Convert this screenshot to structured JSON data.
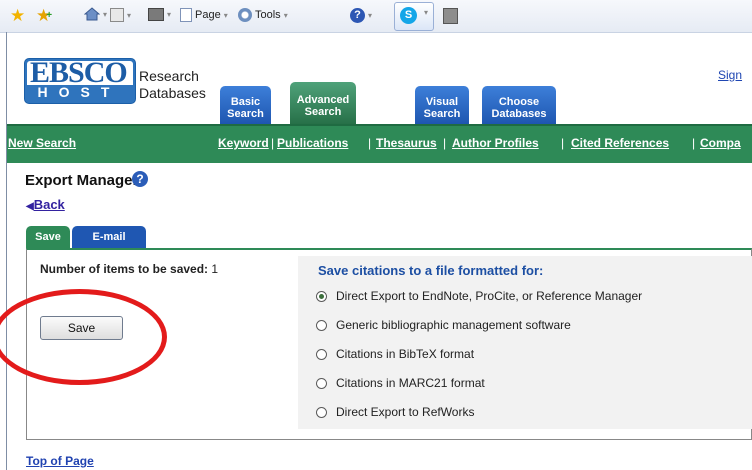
{
  "browser": {
    "page_menu": "Page",
    "tools_menu": "Tools"
  },
  "header": {
    "brand_line1": "Research",
    "brand_line2": "Databases",
    "signin": "Sign"
  },
  "main_tabs": [
    {
      "line1": "Basic",
      "line2": "Search"
    },
    {
      "line1": "Advanced",
      "line2": "Search"
    },
    {
      "line1": "Visual",
      "line2": "Search"
    },
    {
      "line1": "Choose",
      "line2": "Databases"
    }
  ],
  "nav": {
    "new_search": "New Search",
    "links": [
      "Keyword",
      "Publications",
      "Thesaurus",
      "Author Profiles",
      "Cited References",
      "Compa"
    ]
  },
  "export": {
    "title": "Export Manager",
    "back": "Back",
    "tabs": [
      "Save",
      "E-mail"
    ],
    "count_label": "Number of items to be saved:",
    "count": "1",
    "save_button": "Save",
    "options_heading": "Save citations to a file formatted for:",
    "options": [
      "Direct Export to EndNote, ProCite, or Reference Manager",
      "Generic bibliographic management software",
      "Citations in BibTeX format",
      "Citations in MARC21 format",
      "Direct Export to RefWorks"
    ],
    "selected_option_index": 0
  },
  "footer": {
    "top_of_page": "Top of Page"
  },
  "colors": {
    "nav_green": "#2e8a57",
    "tab_blue": "#1e56b0",
    "annotation_red": "#e31b1b"
  }
}
